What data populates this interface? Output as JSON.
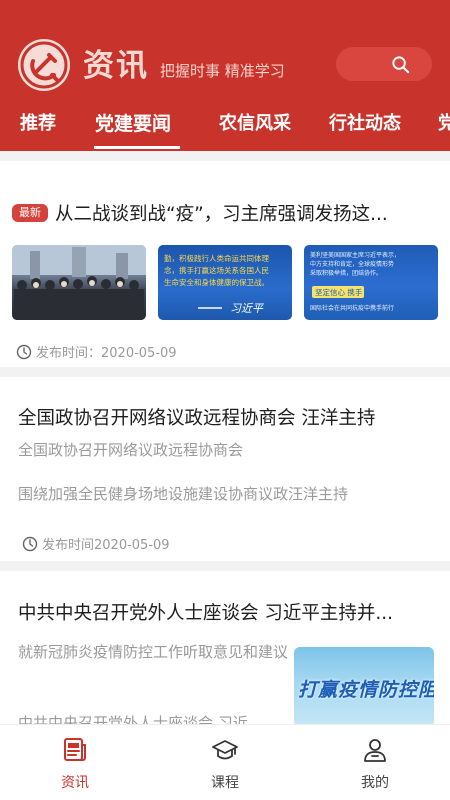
{
  "header": {
    "app_title": "资讯",
    "slogan": "把握时事  精准学习",
    "logo_icon": "party-emblem-icon",
    "search_icon": "search-icon",
    "brand_color": "#c8332c"
  },
  "tabs": [
    {
      "label": "推荐",
      "active": false
    },
    {
      "label": "党建要闻",
      "active": true
    },
    {
      "label": "农信风采",
      "active": false
    },
    {
      "label": "行社动态",
      "active": false
    },
    {
      "label": "党",
      "active": false
    }
  ],
  "articles": [
    {
      "badge": "最新",
      "title": "从二战谈到战“疫”，习主席强调发扬这...",
      "thumb_texts": [
        "",
        "勤，积极践行人类命运共同体理念，携手打赢这场关系各国人民生命安全和身体健康的保卫战。——习近平",
        "美利坚美国国家主席习近平表示，中方支持和肯定，全球疫情形势，坚定信心 携手战“疫”"
      ],
      "meta": "发布时间：2020-05-09"
    },
    {
      "title": "全国政协召开网络议政远程协商会 汪洋主持",
      "sub1": "全国政协召开网络议政远程协商会",
      "sub2": "围绕加强全民健身场地设施建设协商议政汪洋主持",
      "meta": "发布时间2020-05-09"
    },
    {
      "title": "中共中央召开党外人士座谈会 习近平主持并...",
      "summary": "就新冠肺炎疫情防控工作听取意见和建议",
      "summary_cut": "中共中央召开党外人士座谈会 习近",
      "image_text": "打赢疫情防控阻"
    }
  ],
  "bottom_nav": [
    {
      "label": "资讯",
      "icon": "news-icon",
      "active": true
    },
    {
      "label": "课程",
      "icon": "graduation-cap-icon",
      "active": false
    },
    {
      "label": "我的",
      "icon": "user-icon",
      "active": false
    }
  ]
}
